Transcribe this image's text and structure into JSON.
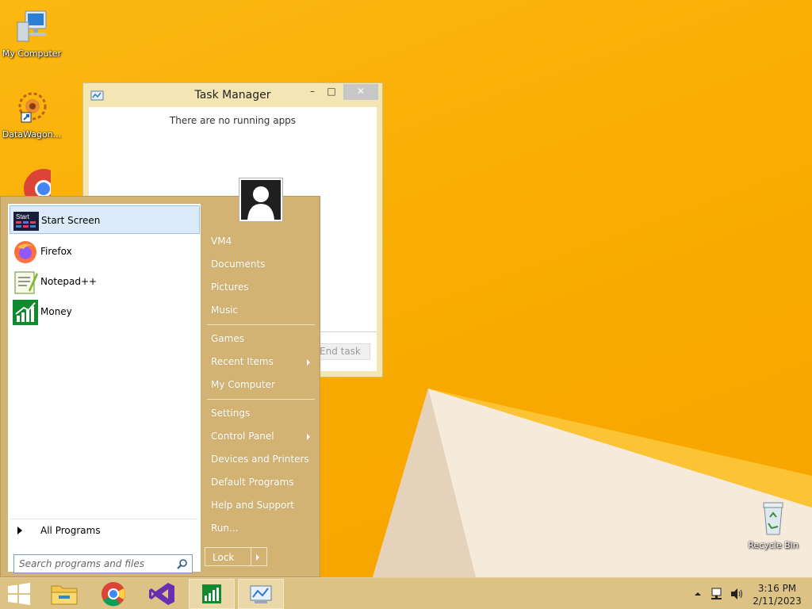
{
  "desktop": {
    "icons": [
      {
        "label": "My Computer"
      },
      {
        "label": "DataWagon..."
      },
      {
        "label": "Recycle Bin"
      }
    ]
  },
  "task_manager": {
    "title": "Task Manager",
    "empty_message": "There are no running apps",
    "end_task_label": "End task",
    "minimize_glyph": "–",
    "maximize_glyph": "□",
    "close_glyph": "✕"
  },
  "start_menu": {
    "programs": [
      {
        "label": "Start Screen",
        "icon": "start-screen-icon"
      },
      {
        "label": "Firefox",
        "icon": "firefox-icon"
      },
      {
        "label": "Notepad++",
        "icon": "notepadpp-icon"
      },
      {
        "label": "Money",
        "icon": "money-icon"
      }
    ],
    "all_programs_label": "All Programs",
    "search_placeholder": "Search programs and files",
    "right_items": {
      "user": "VM4",
      "documents": "Documents",
      "pictures": "Pictures",
      "music": "Music",
      "games": "Games",
      "recent_items": "Recent Items",
      "my_computer": "My Computer",
      "settings": "Settings",
      "control_panel": "Control Panel",
      "devices_printers": "Devices and Printers",
      "default_programs": "Default Programs",
      "help_support": "Help and Support",
      "run": "Run..."
    },
    "lock_label": "Lock"
  },
  "taskbar": {
    "items": [
      "start-button",
      "file-explorer",
      "chrome",
      "visual-studio",
      "money",
      "task-manager"
    ],
    "clock_time": "3:16 PM",
    "clock_date": "2/11/2023"
  },
  "colors": {
    "desktop": "#f9ab00",
    "start_menu_bg": "#d2b373",
    "taskbar": "#dcc285",
    "selection": "#dceaf9"
  }
}
